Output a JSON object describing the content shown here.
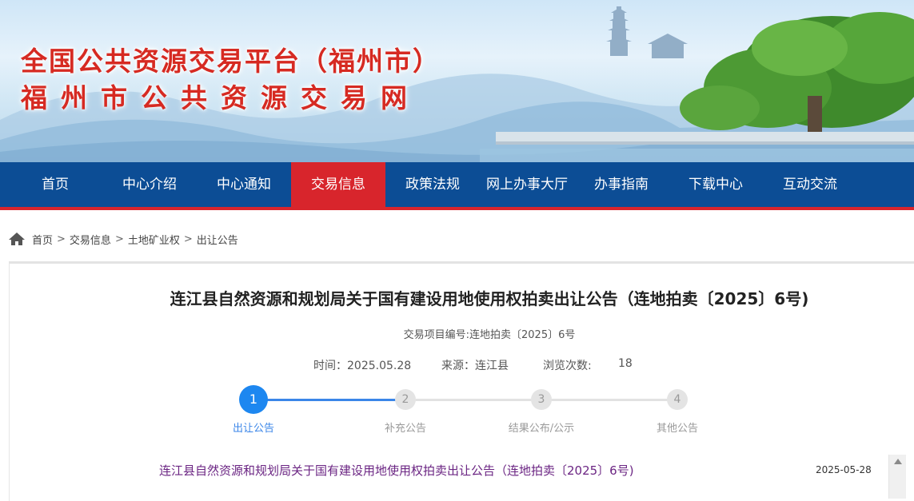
{
  "header": {
    "title": "全国公共资源交易平台（福州市）",
    "subtitle": "福州市公共资源交易网"
  },
  "nav": {
    "items": [
      "首页",
      "中心介绍",
      "中心通知",
      "交易信息",
      "政策法规",
      "网上办事大厅",
      "办事指南",
      "下载中心",
      "互动交流"
    ],
    "active": "交易信息"
  },
  "breadcrumb": {
    "items": [
      "首页",
      "交易信息",
      "土地矿业权",
      "出让公告"
    ],
    "separator": ">"
  },
  "article": {
    "title": "连江县自然资源和规划局关于国有建设用地使用权拍卖出让公告（连地拍卖〔2025〕6号)",
    "project_code": "交易项目编号:连地拍卖〔2025〕6号",
    "time_label": "时间：2025.05.28",
    "source_label": "来源：连江县",
    "views_label": "浏览次数:",
    "views": "18"
  },
  "steps": [
    {
      "num": "1",
      "label": "出让公告",
      "active": true
    },
    {
      "num": "2",
      "label": "补充公告",
      "active": false
    },
    {
      "num": "3",
      "label": "结果公布/公示",
      "active": false
    },
    {
      "num": "4",
      "label": "其他公告",
      "active": false
    }
  ],
  "list": [
    {
      "title": "连江县自然资源和规划局关于国有建设用地使用权拍卖出让公告（连地拍卖〔2025〕6号)",
      "date": "2025-05-28"
    }
  ],
  "colors": {
    "nav_bg": "#0c4d95",
    "nav_active": "#d8252c",
    "title_red": "#d62a22",
    "step_blue": "#1d87f0",
    "link_purple": "#6b2583"
  }
}
